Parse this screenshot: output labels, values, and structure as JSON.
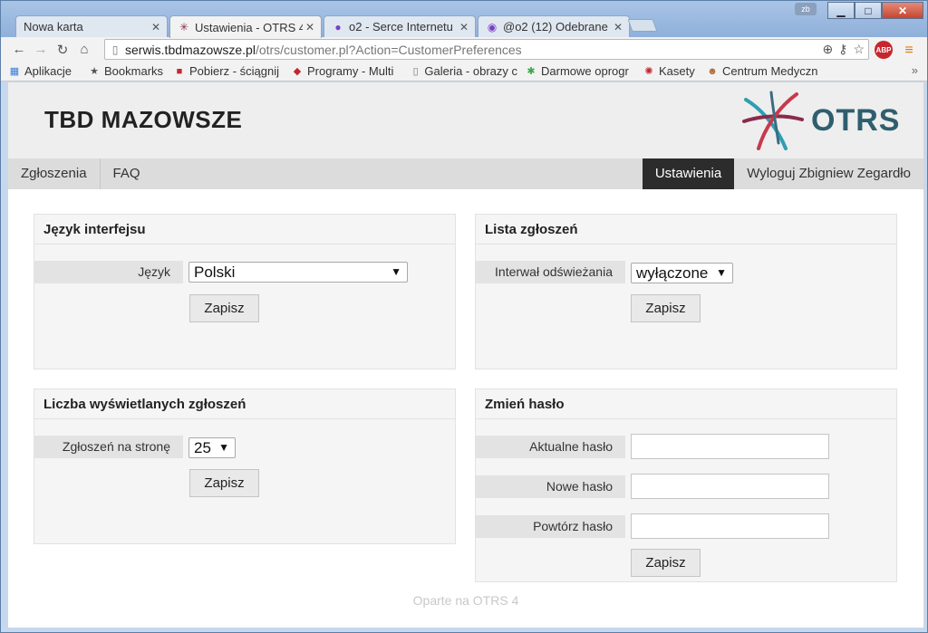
{
  "browser": {
    "profile": "zb",
    "tabs": [
      {
        "title": "Nowa karta"
      },
      {
        "title": "Ustawienia - OTRS 4"
      },
      {
        "title": "o2 - Serce Internetu"
      },
      {
        "title": "@o2 (12) Odebrane"
      }
    ],
    "url_host": "serwis.tbdmazowsze.pl",
    "url_path": "/otrs/customer.pl?Action=CustomerPreferences",
    "abp_label": "ABP",
    "bookmarks": [
      {
        "label": "Aplikacje"
      },
      {
        "label": "Bookmarks"
      },
      {
        "label": "Pobierz - ściągnij"
      },
      {
        "label": "Programy - Multi"
      },
      {
        "label": "Galeria - obrazy c"
      },
      {
        "label": "Darmowe oprogr"
      },
      {
        "label": "Kasety"
      },
      {
        "label": "Centrum Medyczn"
      }
    ],
    "bookmarks_more": "»"
  },
  "header": {
    "company": "TBD MAZOWSZE",
    "logo_text": "OTRS"
  },
  "nav": {
    "tickets": "Zgłoszenia",
    "faq": "FAQ",
    "settings": "Ustawienia",
    "logout": "Wyloguj Zbigniew Zegardło"
  },
  "panels": {
    "language": {
      "title": "Język interfejsu",
      "label": "Język",
      "value": "Polski",
      "save": "Zapisz"
    },
    "ticket_list": {
      "title": "Lista zgłoszeń",
      "label": "Interwał odświeżania",
      "value": "wyłączone",
      "save": "Zapisz"
    },
    "shown_tickets": {
      "title": "Liczba wyświetlanych zgłoszeń",
      "label": "Zgłoszeń na stronę",
      "value": "25",
      "save": "Zapisz"
    },
    "password": {
      "title": "Zmień hasło",
      "current_label": "Aktualne hasło",
      "new_label": "Nowe hasło",
      "repeat_label": "Powtórz hasło",
      "save": "Zapisz"
    }
  },
  "footer": "Oparte na OTRS 4",
  "colors": {
    "accent_nav": "#2c2c2c",
    "logo": "#2e5f6e"
  }
}
